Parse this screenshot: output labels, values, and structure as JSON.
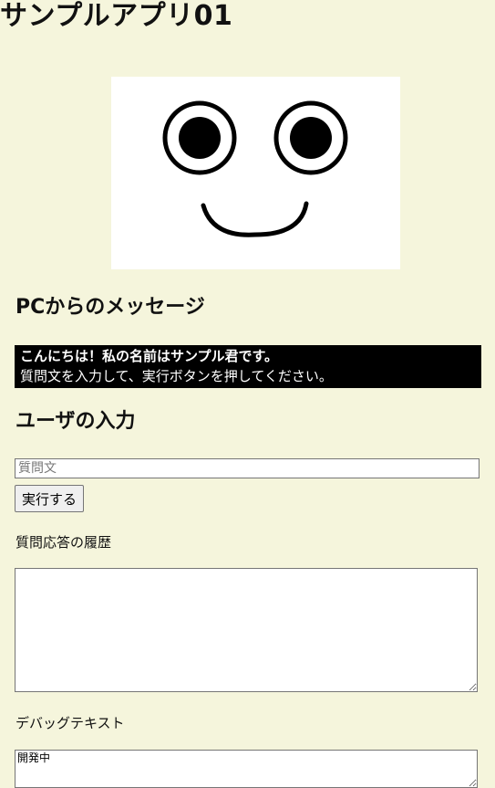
{
  "app": {
    "title": "サンプルアプリ01"
  },
  "pc_section": {
    "heading": "PCからのメッセージ",
    "greeting": "こんにちは！私の名前はサンプル君です。",
    "instruction": "質問文を入力して、実行ボタンを押してください。"
  },
  "user_section": {
    "heading": "ユーザの入力",
    "question_placeholder": "質問文",
    "question_value": "",
    "run_button_label": "実行する"
  },
  "history": {
    "label": "質問応答の履歴",
    "value": ""
  },
  "debug": {
    "label": "デバッグテキスト",
    "value": "開発中"
  },
  "avatar": {
    "icon": "smiley-face-icon",
    "background": "#ffffff",
    "stroke": "#000000"
  },
  "colors": {
    "page_background": "#f5f5dc",
    "message_background": "#000000",
    "message_text": "#ffffff"
  }
}
